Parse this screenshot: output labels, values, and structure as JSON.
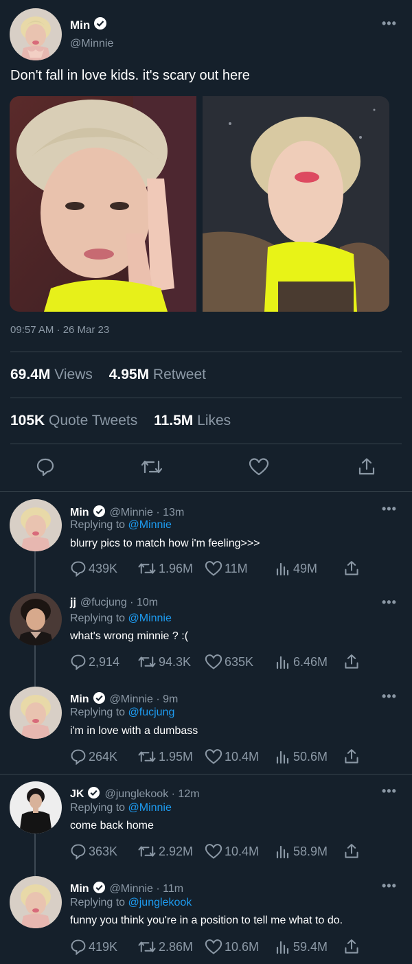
{
  "main": {
    "name": "Min",
    "handle": "@Minnie",
    "more": "•••",
    "text": "Don't fall in love kids. it's scary out here",
    "timestamp": "09:57 AM · 26 Mar 23",
    "views_count": "69.4M",
    "views_label": "Views",
    "retweets_count": "4.95M",
    "retweets_label": "Retweet",
    "quotes_count": "105K",
    "quotes_label": "Quote Tweets",
    "likes_count": "11.5M",
    "likes_label": "Likes",
    "actions": [
      "reply-icon",
      "retweet-icon",
      "heart-icon",
      "share-icon"
    ]
  },
  "replies": [
    {
      "name": "Min",
      "verified": true,
      "handle": "@Minnie · 13m",
      "replying_prefix": "Replying to",
      "replying_to": "@Minnie",
      "text": "blurry pics to match how i'm feeling>>>",
      "replies": "439K",
      "retweets": "1.96M",
      "likes": "11M",
      "views": "49M",
      "more": "•••"
    },
    {
      "name": "jj",
      "verified": false,
      "handle": "@fucjung · 10m",
      "replying_prefix": "Replying to",
      "replying_to": "@Minnie",
      "text": "what's wrong minnie ? :(",
      "replies": "2,914",
      "retweets": "94.3K",
      "likes": "635K",
      "views": "6.46M",
      "more": "•••"
    },
    {
      "name": "Min",
      "verified": true,
      "handle": "@Minnie · 9m",
      "replying_prefix": "Replying to",
      "replying_to": "@fucjung",
      "text": "i'm in love with a dumbass",
      "replies": "264K",
      "retweets": "1.95M",
      "likes": "10.4M",
      "views": "50.6M",
      "more": "•••"
    },
    {
      "name": "JK",
      "verified": true,
      "handle": "@junglekook · 12m",
      "replying_prefix": "Replying to",
      "replying_to": "@Minnie",
      "text": "come back home",
      "replies": "363K",
      "retweets": "2.92M",
      "likes": "10.4M",
      "views": "58.9M",
      "more": "•••"
    },
    {
      "name": "Min",
      "verified": true,
      "handle": "@Minnie · 11m",
      "replying_prefix": "Replying to",
      "replying_to": "@junglekook",
      "text": "funny you think you're in a position to tell me what to do.",
      "replies": "419K",
      "retweets": "2.86M",
      "likes": "10.6M",
      "views": "59.4M",
      "more": "•••"
    }
  ],
  "colors": {
    "background": "#15202b",
    "muted": "#8b98a5",
    "accent": "#1d9bf0",
    "divider": "#38444d"
  }
}
